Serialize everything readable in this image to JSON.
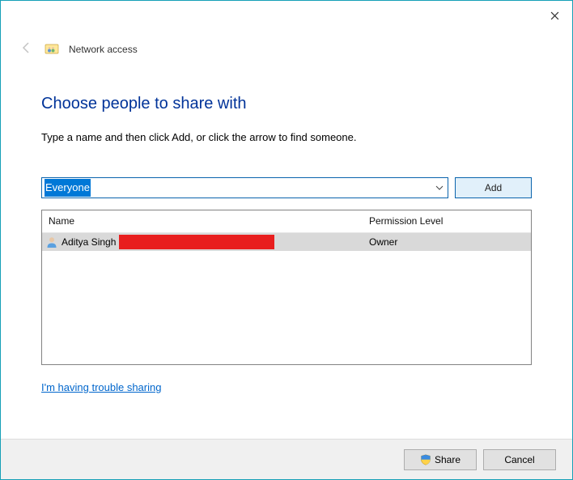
{
  "window": {
    "title": "Network access"
  },
  "content": {
    "heading": "Choose people to share with",
    "subtext": "Type a name and then click Add, or click the arrow to find someone.",
    "combo_value": "Everyone",
    "add_button": "Add",
    "trouble_link": "I'm having trouble sharing"
  },
  "table": {
    "headers": {
      "name": "Name",
      "permission": "Permission Level"
    },
    "rows": [
      {
        "name": "Aditya Singh",
        "permission": "Owner"
      }
    ]
  },
  "footer": {
    "share": "Share",
    "cancel": "Cancel"
  }
}
